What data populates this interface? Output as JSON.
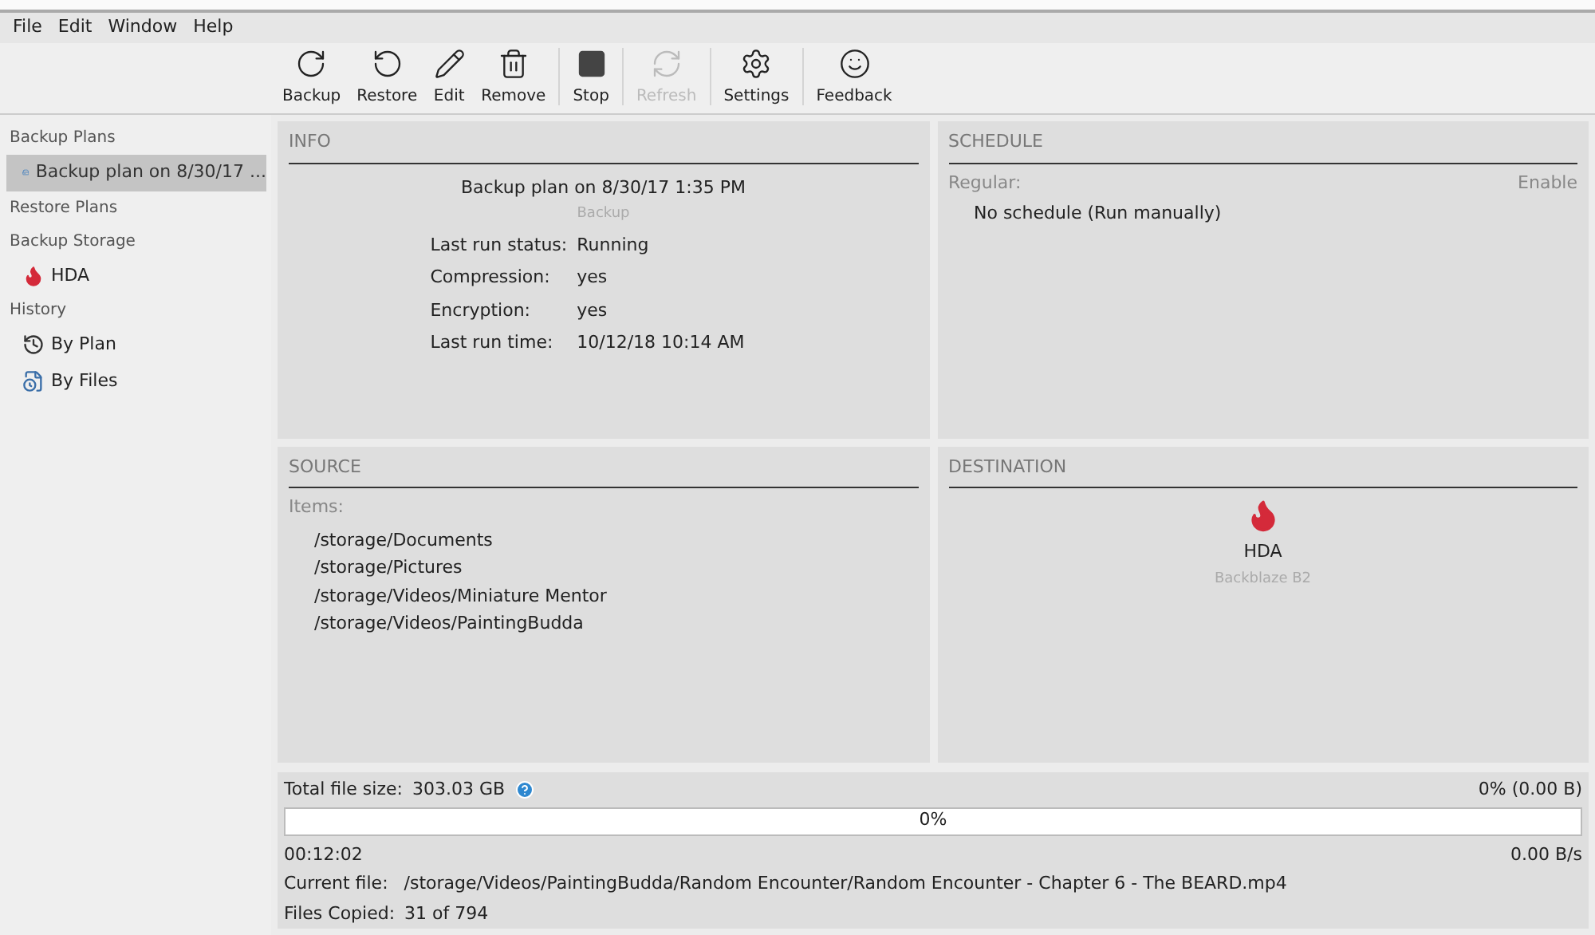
{
  "menu": [
    "File",
    "Edit",
    "Window",
    "Help"
  ],
  "toolbar": [
    {
      "label": "Backup",
      "kind": "backup",
      "disabled": false,
      "separator_after": false
    },
    {
      "label": "Restore",
      "kind": "restore",
      "disabled": false,
      "separator_after": false
    },
    {
      "label": "Edit",
      "kind": "edit",
      "disabled": false,
      "separator_after": false
    },
    {
      "label": "Remove",
      "kind": "remove",
      "disabled": false,
      "separator_after": true
    },
    {
      "label": "Stop",
      "kind": "stop",
      "disabled": false,
      "separator_after": true
    },
    {
      "label": "Refresh",
      "kind": "refresh",
      "disabled": true,
      "separator_after": true
    },
    {
      "label": "Settings",
      "kind": "settings",
      "disabled": false,
      "separator_after": true
    },
    {
      "label": "Feedback",
      "kind": "feedback",
      "disabled": false,
      "separator_after": false
    }
  ],
  "sidebar": [
    {
      "heading": "Backup Plans",
      "items": [
        {
          "label": "Backup plan on 8/30/17 ...",
          "kind": "plan",
          "selected": true
        }
      ]
    },
    {
      "heading": "Restore Plans"
    },
    {
      "heading": "Backup Storage",
      "items": [
        {
          "label": "HDA",
          "kind": "storage",
          "selected": false
        }
      ]
    },
    {
      "heading": "History",
      "items": [
        {
          "label": "By Plan",
          "kind": "history",
          "selected": false
        },
        {
          "label": "By Files",
          "kind": "files",
          "selected": false
        }
      ]
    }
  ],
  "info": {
    "title": "INFO",
    "plan_name": "Backup plan on 8/30/17 1:35 PM",
    "plan_type": "Backup",
    "rows": [
      {
        "label": "Last run status:",
        "value": "Running"
      },
      {
        "label": "Compression:",
        "value": "yes"
      },
      {
        "label": "Encryption:",
        "value": "yes"
      },
      {
        "label": "Last run time:",
        "value": "10/12/18 10:14 AM"
      }
    ]
  },
  "schedule": {
    "title": "SCHEDULE",
    "label": "Regular:",
    "action": "Enable",
    "value": "No schedule (Run manually)"
  },
  "source": {
    "title": "SOURCE",
    "label": "Items:",
    "items": [
      "/storage/Documents",
      "/storage/Pictures",
      "/storage/Videos/Miniature Mentor",
      "/storage/Videos/PaintingBudda"
    ]
  },
  "destination": {
    "title": "DESTINATION",
    "name": "HDA",
    "provider": "Backblaze B2"
  },
  "progress": {
    "total_label": "Total file size:",
    "total_value": "303.03 GB",
    "percent_done": "0% (0.00 B)",
    "level": 0,
    "bar_text": "0%",
    "elapsed": "00:12:02",
    "speed": "0.00 B/s",
    "current_label": "Current file:",
    "current_value": "/storage/Videos/PaintingBudda/Random Encounter/Random Encounter - Chapter 6 - The BEARD.mp4",
    "copied_label": "Files Copied:",
    "copied_value": "31 of 794"
  }
}
